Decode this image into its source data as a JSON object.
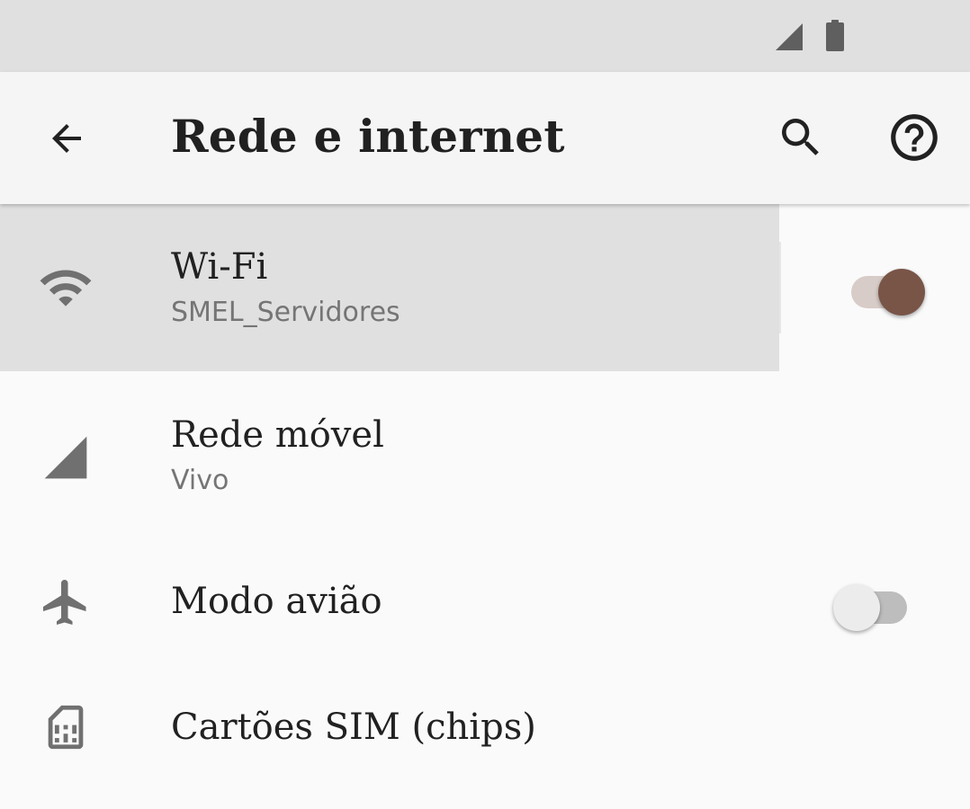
{
  "status_bar": {
    "icons": [
      "cell-signal-icon",
      "battery-icon"
    ]
  },
  "toolbar": {
    "title": "Rede e internet",
    "back_icon": "arrow-back-icon",
    "search_icon": "search-icon",
    "help_icon": "help-circle-icon"
  },
  "settings": {
    "wifi": {
      "title": "Wi-Fi",
      "subtitle": "SMEL_Servidores",
      "icon": "wifi-icon",
      "toggle_on": true
    },
    "mobile_network": {
      "title": "Rede móvel",
      "subtitle": "Vivo",
      "icon": "cell-signal-icon"
    },
    "airplane_mode": {
      "title": "Modo avião",
      "icon": "airplane-icon",
      "toggle_on": false
    },
    "sim_cards": {
      "title": "Cartões SIM (chips)",
      "icon": "sim-card-icon"
    }
  },
  "colors": {
    "accent": "#795548",
    "accent_track": "#d7ccc8",
    "text_primary": "#212121",
    "text_secondary": "#757575",
    "icon": "#707070",
    "toolbar_bg": "#f5f5f5",
    "status_bar_bg": "#e0e0e0",
    "highlight_bg": "#e0e0e0"
  }
}
